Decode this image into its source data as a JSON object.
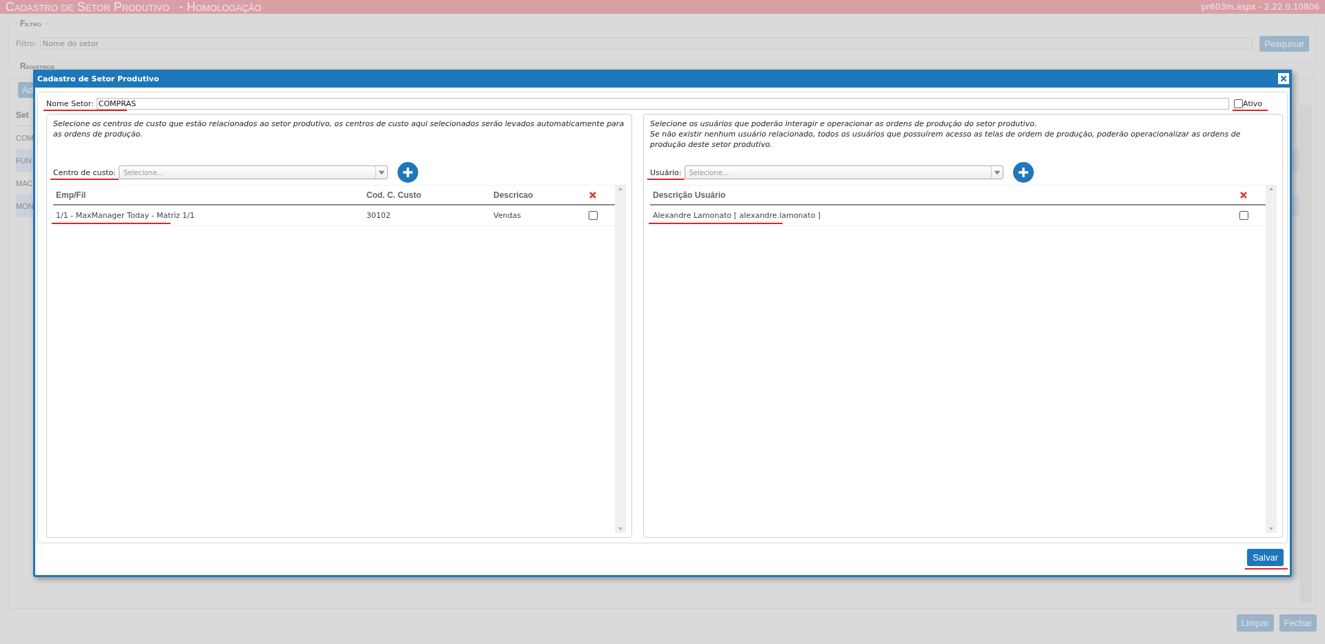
{
  "header": {
    "title": "Cadastro de Setor Produtivo",
    "environment": "- Homologação",
    "version": "pr603m.aspx - 2.22.0.10806"
  },
  "filter": {
    "legend": "Filtro",
    "label": "Filtro:",
    "placeholder": "Nome do setor",
    "button": "Pesquisar"
  },
  "records": {
    "legend": "Registros",
    "add_button": "Ad",
    "column_1": "Set",
    "rows": [
      "COM",
      "FUN",
      "MAC",
      "MON"
    ]
  },
  "footer_buttons": [
    "Limpar",
    "Fechar"
  ],
  "dialog": {
    "title": "Cadastro de Setor Produtivo",
    "name_label": "Nome Setor:",
    "name_value": "COMPRAS",
    "active": {
      "label": "Ativo",
      "checked": false
    },
    "cost_centers": {
      "description": [
        "Selecione os centros de custo que estão relacionados ao setor produtivo, os centros de custo aqui selecionados serão levados automaticamente para as ordens de produção."
      ],
      "select_label": "Centro de custo:",
      "select_placeholder": "Selecione...",
      "columns": [
        "Emp/Fil",
        "Cod. C. Custo",
        "Descricao"
      ],
      "rows": [
        {
          "cells": [
            "1/1 - MaxManager Today - Matriz 1/1",
            "30102",
            "Vendas"
          ],
          "checked": false
        }
      ]
    },
    "users": {
      "description": [
        "Selecione os usuários que poderão interagir e operacionar as ordens de produção do setor produtivo.",
        "Se não existir nenhum usuário relacionado, todos os usuários que possuírem acesso as telas de ordem de produção, poderão operacionalizar as ordens de produção deste setor produtivo."
      ],
      "select_label": "Usuário:",
      "select_placeholder": "Selecione...",
      "columns": [
        "Descrição Usuário"
      ],
      "rows": [
        {
          "cells": [
            "Alexandre Lamonato [ alexandre.lamonato ]"
          ],
          "checked": false
        }
      ]
    },
    "save_button": "Salvar"
  }
}
